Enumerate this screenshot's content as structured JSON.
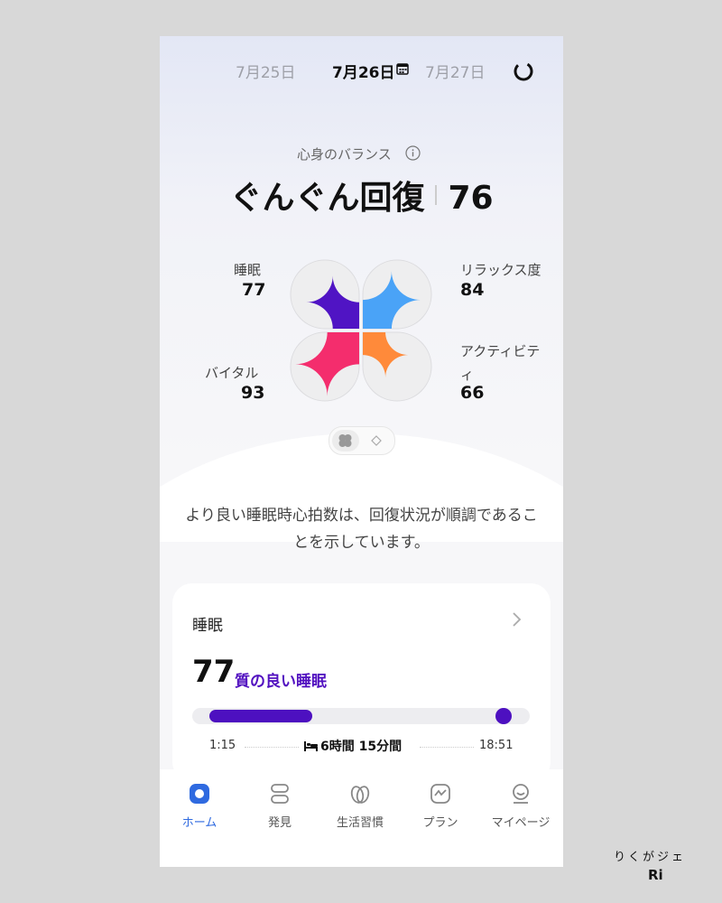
{
  "dates": {
    "prev": "7月25日",
    "current": "7月26日",
    "next": "7月27日"
  },
  "balance": {
    "label": "心身のバランス",
    "status": "ぐんぐん回復",
    "score": "76"
  },
  "metrics": {
    "sleep": {
      "label": "睡眠",
      "value": "77",
      "color": "#5014c4",
      "fill": 0.77
    },
    "relax": {
      "label": "リラックス度",
      "value": "84",
      "color": "#4aa3f7",
      "fill": 0.84
    },
    "vital": {
      "label": "バイタル",
      "value": "93",
      "color": "#f42d6d",
      "fill": 0.93
    },
    "activity": {
      "label": "アクティビティ",
      "value": "66",
      "color": "#ff8a3a",
      "fill": 0.66
    }
  },
  "message": "より良い睡眠時心拍数は、回復状況が順調であることを示しています。",
  "sleep_card": {
    "title": "睡眠",
    "score": "77",
    "quality": "質の良い睡眠",
    "start": "1:15",
    "duration": "6時間 15分間",
    "end": "18:51",
    "accent": "#4d10c0"
  },
  "tabs": [
    {
      "label": "ホーム",
      "icon": "home-icon",
      "active": true
    },
    {
      "label": "発見",
      "icon": "discover-icon",
      "active": false
    },
    {
      "label": "生活習慣",
      "icon": "habits-icon",
      "active": false
    },
    {
      "label": "プラン",
      "icon": "plan-icon",
      "active": false
    },
    {
      "label": "マイページ",
      "icon": "mypage-icon",
      "active": false
    }
  ],
  "accent_color": "#2f6ae0",
  "watermark": {
    "line1": "りくがジェ",
    "line2": "Ri"
  }
}
